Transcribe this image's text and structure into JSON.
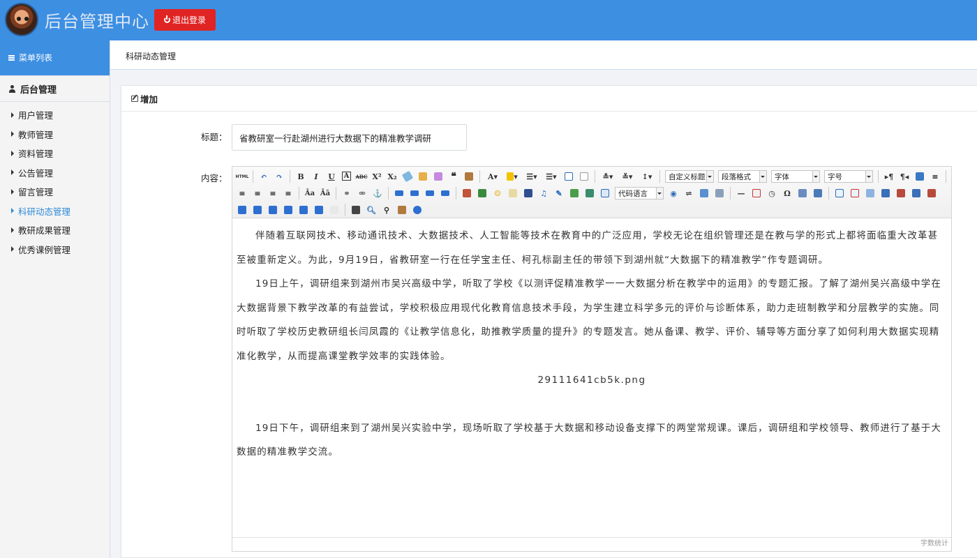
{
  "header": {
    "app_title": "后台管理中心",
    "logout_label": "退出登录",
    "colors": {
      "header_bg": "#3d8fe2",
      "logout_bg": "#e02424"
    }
  },
  "sidebar": {
    "menu_list_label": "菜单列表",
    "group_title": "后台管理",
    "items": [
      {
        "label": "用户管理",
        "active": false
      },
      {
        "label": "教师管理",
        "active": false
      },
      {
        "label": "资料管理",
        "active": false
      },
      {
        "label": "公告管理",
        "active": false
      },
      {
        "label": "留言管理",
        "active": false
      },
      {
        "label": "科研动态管理",
        "active": true
      },
      {
        "label": "教研成果管理",
        "active": false
      },
      {
        "label": "优秀课例管理",
        "active": false
      }
    ]
  },
  "tabbar": {
    "current_tab": "科研动态管理"
  },
  "panel": {
    "header_label": "增加"
  },
  "form": {
    "title_label": "标题：",
    "title_value": "省教研室一行赴湖州进行大数据下的精准教学调研",
    "content_label": "内容："
  },
  "editor": {
    "toolbar": {
      "combos": [
        "自定义标题",
        "段落格式",
        "字体",
        "字号",
        "代码语言"
      ],
      "html_label": "HTML"
    },
    "paragraphs": [
      "伴随着互联网技术、移动通讯技术、大数据技术、人工智能等技术在教育中的广泛应用，学校无论在组织管理还是在教与学的形式上都将面临重大改革甚至被重新定义。为此，9月19日，省教研室一行在任学宝主任、柯孔标副主任的带领下到湖州就“大数据下的精准教学”作专题调研。",
      "19日上午，调研组来到湖州市吴兴高级中学，听取了学校《以测评促精准教学一一大数据分析在教学中的运用》的专题汇报。了解了湖州吴兴高级中学在大数据背景下教学改革的有益尝试，学校积极应用现代化教育信息技术手段，为学生建立科学多元的评价与诊断体系，助力走班制教学和分层教学的实施。同时听取了学校历史教研组长闫凤霞的《让教学信息化，助推教学质量的提升》的专题发言。她从备课、教学、评价、辅导等方面分享了如何利用大数据实现精准化教学，从而提高课堂教学效率的实践体验。",
      "19日下午，调研组来到了湖州吴兴实验中学，现场听取了学校基于大数据和移动设备支撑下的两堂常规课。课后，调研组和学校领导、教师进行了基于大数据的精准教学交流。"
    ],
    "image_filename": "29111641cb5k.png",
    "word_count_label": "字数统计"
  }
}
